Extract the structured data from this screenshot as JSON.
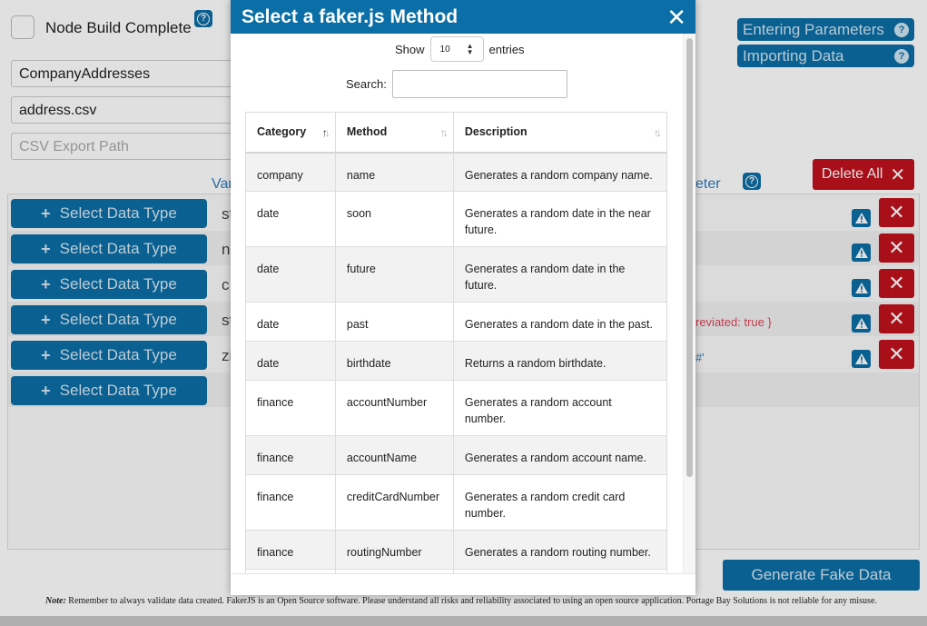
{
  "page": {
    "node_build_label": "Node Build Complete",
    "inputs": {
      "table_name": "CompanyAddresses",
      "file_name": "address.csv",
      "csv_path_placeholder": "CSV Export Path"
    },
    "help_buttons": {
      "entering_parameters": "Entering Parameters",
      "importing_data": "Importing Data"
    },
    "column_headers": {
      "variable_fragment": "Var",
      "parameter_fragment": "eter"
    },
    "delete_all_label": "Delete All",
    "select_data_type_label": "Select Data Type",
    "rows": [
      {
        "char": "st",
        "param_text": ""
      },
      {
        "char": "n",
        "param_text": ""
      },
      {
        "char": "c",
        "param_text": ""
      },
      {
        "char": "st",
        "param_text": "reviated: true }"
      },
      {
        "char": "zi",
        "param_text": "#'"
      }
    ],
    "generate_button": "Generate Fake Data",
    "note_label": "Note:",
    "note_text": "Remember to always validate data created. FakerJS is an Open Source software. Please understand all risks and reliability associated to using an open source application. Portage Bay Solutions is not reliable for any misuse."
  },
  "modal": {
    "title": "Select a faker.js Method",
    "close_glyph": "✕",
    "show_label": "Show",
    "entries_value": "10",
    "entries_label": "entries",
    "search_label": "Search:",
    "search_value": "",
    "columns": [
      "Category",
      "Method",
      "Description"
    ],
    "rows": [
      {
        "category": "company",
        "method": "name",
        "description": "Generates a random company name."
      },
      {
        "category": "date",
        "method": "soon",
        "description": "Generates a random date in the near future."
      },
      {
        "category": "date",
        "method": "future",
        "description": "Generates a random date in the future."
      },
      {
        "category": "date",
        "method": "past",
        "description": "Generates a random date in the past."
      },
      {
        "category": "date",
        "method": "birthdate",
        "description": "Returns a random birthdate."
      },
      {
        "category": "finance",
        "method": "accountNumber",
        "description": "Generates a random account number."
      },
      {
        "category": "finance",
        "method": "accountName",
        "description": "Generates a random account name."
      },
      {
        "category": "finance",
        "method": "creditCardNumber",
        "description": "Generates a random credit card number."
      },
      {
        "category": "finance",
        "method": "routingNumber",
        "description": "Generates a random routing number."
      }
    ]
  },
  "colors": {
    "brand_blue": "#0b6ea6",
    "danger_red": "#c0121d",
    "link_blue": "#2e7bbf",
    "param_red": "#e0455a"
  }
}
